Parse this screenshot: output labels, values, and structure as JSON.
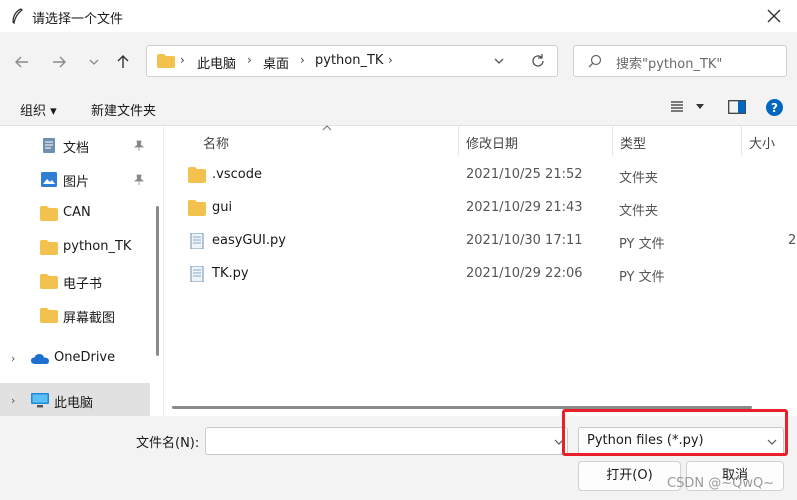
{
  "window": {
    "title": "请选择一个文件",
    "close_icon": "close-icon"
  },
  "nav": {
    "back_icon": "arrow-left-icon",
    "forward_icon": "arrow-right-icon",
    "recent_icon": "chevron-down-icon",
    "up_icon": "arrow-up-icon",
    "breadcrumb": [
      "此电脑",
      "桌面",
      "python_TK"
    ],
    "search_placeholder": "搜索\"python_TK\""
  },
  "toolbar": {
    "organize_label": "组织 ▾",
    "new_folder_label": "新建文件夹"
  },
  "sidebar": {
    "items": [
      {
        "label": "文档",
        "icon": "document-icon",
        "pinned": true
      },
      {
        "label": "图片",
        "icon": "picture-icon",
        "pinned": true
      },
      {
        "label": "CAN",
        "icon": "folder-icon",
        "pinned": false
      },
      {
        "label": "python_TK",
        "icon": "folder-icon",
        "pinned": false
      },
      {
        "label": "电子书",
        "icon": "folder-icon",
        "pinned": false
      },
      {
        "label": "屏幕截图",
        "icon": "folder-icon",
        "pinned": false
      },
      {
        "label": "OneDrive",
        "icon": "cloud-icon",
        "pinned": false
      },
      {
        "label": "此电脑",
        "icon": "computer-icon",
        "pinned": false
      }
    ]
  },
  "columns": {
    "name": "名称",
    "modified": "修改日期",
    "type": "类型",
    "size": "大小"
  },
  "files": [
    {
      "name": ".vscode",
      "modified": "2021/10/25 21:52",
      "type": "文件夹",
      "size": "",
      "icon": "folder-icon"
    },
    {
      "name": "gui",
      "modified": "2021/10/29 21:43",
      "type": "文件夹",
      "size": "",
      "icon": "folder-icon"
    },
    {
      "name": "easyGUI.py",
      "modified": "2021/10/30 17:11",
      "type": "PY 文件",
      "size": "2",
      "icon": "python-file-icon"
    },
    {
      "name": "TK.py",
      "modified": "2021/10/29 22:06",
      "type": "PY 文件",
      "size": "",
      "icon": "python-file-icon"
    }
  ],
  "bottom": {
    "filename_label": "文件名(N):",
    "filename_value": "",
    "filetype_selected": "Python files (*.py)",
    "open_label": "打开(O)",
    "cancel_label": "取消",
    "watermark": "CSDN @~QwQ~"
  },
  "colors": {
    "highlight": "#e8202a",
    "folder": "#f2c14e",
    "accent": "#0067c0"
  }
}
